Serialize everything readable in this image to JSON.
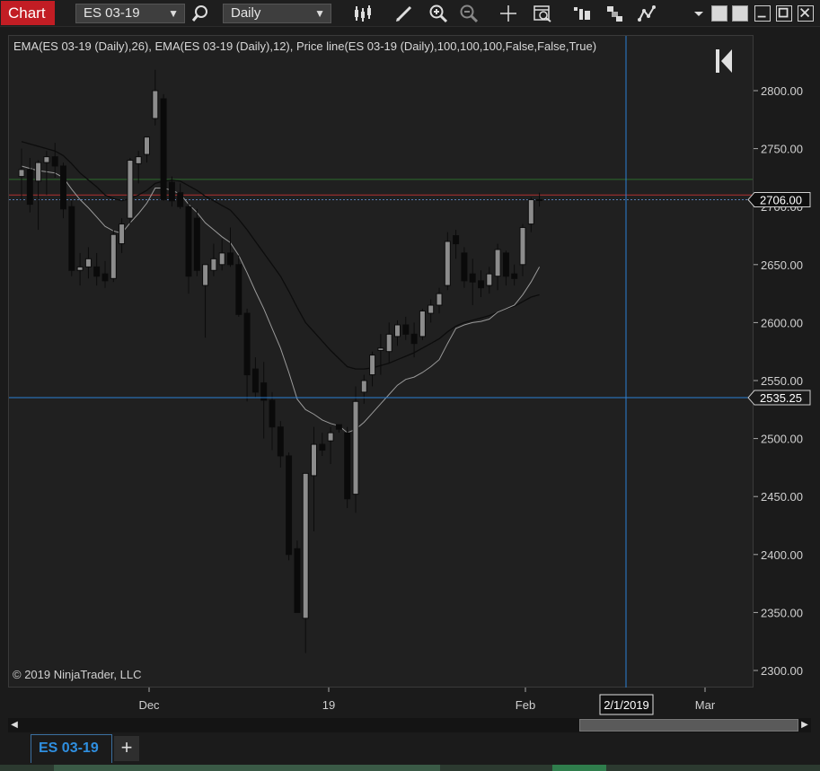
{
  "toolbar": {
    "chart_label": "Chart",
    "instrument": "ES 03-19",
    "interval": "Daily"
  },
  "chart": {
    "indicator_label": "EMA(ES 03-19 (Daily),26), EMA(ES 03-19 (Daily),12), Price line(ES 03-19 (Daily),100,100,100,False,False,True)",
    "copyright": "© 2019 NinjaTrader, LLC",
    "price_ticks": [
      "2800.00",
      "2750.00",
      "2700.00",
      "2650.00",
      "2600.00",
      "2550.00",
      "2500.00",
      "2450.00",
      "2400.00",
      "2350.00",
      "2300.00"
    ],
    "price_tick_values": [
      2800,
      2750,
      2700,
      2650,
      2600,
      2550,
      2500,
      2450,
      2400,
      2350,
      2300
    ],
    "time_ticks": [
      "Dec",
      "19",
      "Feb",
      "Mar"
    ],
    "crosshair_date": "2/1/2019",
    "last_price_label": "2706.00",
    "crosshair_price_label": "2535.25",
    "last_price": 2706.0,
    "crosshair_price": 2535.25,
    "green_line_price": 2723.5,
    "red_line_price": 2710.0,
    "price_line_color": "#5a7fb8",
    "up_color": "#8c8c8c",
    "down_color": "#0a0a0a",
    "ema26_color": "#0c0c0c",
    "ema12_color": "#9a9a9a"
  },
  "candles": [
    {
      "o": 2726,
      "h": 2750,
      "l": 2705,
      "c": 2732
    },
    {
      "o": 2732,
      "h": 2742,
      "l": 2695,
      "c": 2702
    },
    {
      "o": 2722,
      "h": 2740,
      "l": 2680,
      "c": 2738
    },
    {
      "o": 2738,
      "h": 2748,
      "l": 2710,
      "c": 2743
    },
    {
      "o": 2743,
      "h": 2755,
      "l": 2725,
      "c": 2735
    },
    {
      "o": 2735,
      "h": 2738,
      "l": 2690,
      "c": 2698
    },
    {
      "o": 2700,
      "h": 2705,
      "l": 2640,
      "c": 2645
    },
    {
      "o": 2645,
      "h": 2660,
      "l": 2632,
      "c": 2648
    },
    {
      "o": 2648,
      "h": 2665,
      "l": 2638,
      "c": 2655
    },
    {
      "o": 2648,
      "h": 2660,
      "l": 2632,
      "c": 2640
    },
    {
      "o": 2642,
      "h": 2653,
      "l": 2630,
      "c": 2636
    },
    {
      "o": 2638,
      "h": 2680,
      "l": 2635,
      "c": 2676
    },
    {
      "o": 2668,
      "h": 2690,
      "l": 2660,
      "c": 2685
    },
    {
      "o": 2690,
      "h": 2742,
      "l": 2685,
      "c": 2740
    },
    {
      "o": 2737,
      "h": 2748,
      "l": 2720,
      "c": 2743
    },
    {
      "o": 2745,
      "h": 2760,
      "l": 2738,
      "c": 2760
    },
    {
      "o": 2776,
      "h": 2818,
      "l": 2770,
      "c": 2800
    },
    {
      "o": 2793,
      "h": 2797,
      "l": 2705,
      "c": 2706
    },
    {
      "o": 2721,
      "h": 2726,
      "l": 2700,
      "c": 2705
    },
    {
      "o": 2712,
      "h": 2720,
      "l": 2698,
      "c": 2700
    },
    {
      "o": 2700,
      "h": 2704,
      "l": 2625,
      "c": 2640
    },
    {
      "o": 2690,
      "h": 2698,
      "l": 2640,
      "c": 2645
    },
    {
      "o": 2632,
      "h": 2648,
      "l": 2587,
      "c": 2650
    },
    {
      "o": 2645,
      "h": 2668,
      "l": 2640,
      "c": 2655
    },
    {
      "o": 2650,
      "h": 2672,
      "l": 2645,
      "c": 2660
    },
    {
      "o": 2660,
      "h": 2682,
      "l": 2648,
      "c": 2650
    },
    {
      "o": 2650,
      "h": 2658,
      "l": 2605,
      "c": 2607
    },
    {
      "o": 2608,
      "h": 2612,
      "l": 2532,
      "c": 2555
    },
    {
      "o": 2560,
      "h": 2570,
      "l": 2535,
      "c": 2540
    },
    {
      "o": 2548,
      "h": 2566,
      "l": 2500,
      "c": 2533
    },
    {
      "o": 2533,
      "h": 2540,
      "l": 2490,
      "c": 2510
    },
    {
      "o": 2510,
      "h": 2515,
      "l": 2475,
      "c": 2485
    },
    {
      "o": 2485,
      "h": 2488,
      "l": 2395,
      "c": 2400
    },
    {
      "o": 2405,
      "h": 2412,
      "l": 2350,
      "c": 2350
    },
    {
      "o": 2345,
      "h": 2395,
      "l": 2315,
      "c": 2470
    },
    {
      "o": 2468,
      "h": 2510,
      "l": 2420,
      "c": 2495
    },
    {
      "o": 2495,
      "h": 2505,
      "l": 2485,
      "c": 2490
    },
    {
      "o": 2498,
      "h": 2510,
      "l": 2478,
      "c": 2505
    },
    {
      "o": 2512,
      "h": 2512,
      "l": 2505,
      "c": 2508
    },
    {
      "o": 2505,
      "h": 2510,
      "l": 2440,
      "c": 2448
    },
    {
      "o": 2452,
      "h": 2545,
      "l": 2436,
      "c": 2532
    },
    {
      "o": 2540,
      "h": 2555,
      "l": 2530,
      "c": 2550
    },
    {
      "o": 2555,
      "h": 2575,
      "l": 2545,
      "c": 2572
    },
    {
      "o": 2576,
      "h": 2590,
      "l": 2555,
      "c": 2578
    },
    {
      "o": 2575,
      "h": 2600,
      "l": 2565,
      "c": 2590
    },
    {
      "o": 2588,
      "h": 2602,
      "l": 2580,
      "c": 2598
    },
    {
      "o": 2598,
      "h": 2605,
      "l": 2585,
      "c": 2590
    },
    {
      "o": 2590,
      "h": 2600,
      "l": 2570,
      "c": 2582
    },
    {
      "o": 2588,
      "h": 2612,
      "l": 2585,
      "c": 2610
    },
    {
      "o": 2608,
      "h": 2620,
      "l": 2600,
      "c": 2615
    },
    {
      "o": 2615,
      "h": 2630,
      "l": 2608,
      "c": 2625
    },
    {
      "o": 2632,
      "h": 2678,
      "l": 2628,
      "c": 2670
    },
    {
      "o": 2675,
      "h": 2680,
      "l": 2655,
      "c": 2668
    },
    {
      "o": 2660,
      "h": 2665,
      "l": 2630,
      "c": 2636
    },
    {
      "o": 2642,
      "h": 2655,
      "l": 2615,
      "c": 2635
    },
    {
      "o": 2636,
      "h": 2645,
      "l": 2622,
      "c": 2630
    },
    {
      "o": 2632,
      "h": 2648,
      "l": 2625,
      "c": 2642
    },
    {
      "o": 2640,
      "h": 2668,
      "l": 2628,
      "c": 2663
    },
    {
      "o": 2660,
      "h": 2662,
      "l": 2632,
      "c": 2640
    },
    {
      "o": 2642,
      "h": 2650,
      "l": 2632,
      "c": 2638
    },
    {
      "o": 2650,
      "h": 2685,
      "l": 2640,
      "c": 2682
    },
    {
      "o": 2685,
      "h": 2708,
      "l": 2678,
      "c": 2706
    },
    {
      "o": 2706,
      "h": 2712,
      "l": 2700,
      "c": 2706
    }
  ],
  "ema12": [
    2735,
    2733,
    2731,
    2730,
    2729,
    2725,
    2715,
    2706,
    2699,
    2691,
    2683,
    2679,
    2677,
    2686,
    2694,
    2703,
    2716,
    2716,
    2714,
    2711,
    2702,
    2695,
    2686,
    2680,
    2674,
    2669,
    2658,
    2643,
    2627,
    2612,
    2595,
    2578,
    2557,
    2534,
    2525,
    2521,
    2516,
    2513,
    2511,
    2505,
    2508,
    2514,
    2522,
    2530,
    2538,
    2546,
    2551,
    2553,
    2557,
    2562,
    2568,
    2582,
    2595,
    2598,
    2600,
    2601,
    2603,
    2609,
    2612,
    2615,
    2624,
    2635,
    2648
  ],
  "ema26": [
    2756,
    2754,
    2752,
    2750,
    2748,
    2744,
    2737,
    2729,
    2723,
    2717,
    2710,
    2707,
    2705,
    2707,
    2710,
    2714,
    2720,
    2722,
    2723,
    2722,
    2718,
    2714,
    2709,
    2705,
    2701,
    2697,
    2689,
    2680,
    2670,
    2660,
    2650,
    2640,
    2627,
    2613,
    2600,
    2592,
    2584,
    2576,
    2569,
    2562,
    2560,
    2560,
    2561,
    2563,
    2565,
    2568,
    2571,
    2574,
    2578,
    2582,
    2586,
    2592,
    2597,
    2600,
    2602,
    2604,
    2606,
    2609,
    2612,
    2614,
    2618,
    2622,
    2624
  ]
}
